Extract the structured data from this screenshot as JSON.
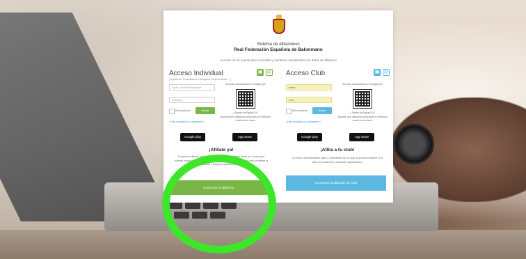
{
  "header": {
    "title": "Sistema de afiliaciones",
    "federation": "Real Federación Española de Balonmano",
    "subtitle": "Accede con tu cuenta para consultar y mantener actualizados tus datos de afiliación"
  },
  "individual": {
    "title": "Acceso Individual",
    "note": "(Jugadores, Entrenadores, Delegados, Responsables, ...)",
    "email_placeholder": "Email o DNI/NIE/Pasaporte",
    "password_placeholder": "Password",
    "remember_label": "Recuerdame",
    "login_button": "Entrar",
    "forgot_link": "¿Has olvidado tu contraseña?",
    "qr_label": "Accede escaneando el código QR",
    "app_question": "¿Tienes imSquad ID?",
    "app_text": "Accede a tu afiliación utilizando tu teléfono móvil como llave.",
    "google_play": "Google play",
    "app_store": "App Store",
    "affiliate_heading": "¡Afíliate ya!",
    "affiliate_text": "Si quieres afiliarte, pulsa en el botón de abajo. Debes tener en cuenta que cuando hayas rellenado el formulario, deberás esperar a que tu club confirme la afiliación y después podrás acceder.",
    "start_button": "Comenzar la afiliación"
  },
  "club": {
    "title": "Acceso Club",
    "user_value": "fuelon",
    "password_value": "••••••",
    "remember_label": "Recuerdame",
    "login_button": "Entrar",
    "forgot_link": "¿Has olvidado tu contraseña?",
    "qr_label": "Accede escaneando el código QR",
    "app_question": "¿Tienes imSquad ID?",
    "app_text": "Accede a tu afiliación utilizando tu teléfono móvil como llave.",
    "google_play": "Google play",
    "app_store": "App Store",
    "affiliate_heading": "¡Afilia a tu club!",
    "affiliate_text": "Si eres el representante legal o presidente de un club ya puedes inscribir a tu club en el sistema y empezar a gestionarlo.",
    "start_button": "Comenzar la afiliación de Club"
  },
  "colors": {
    "green": "#7ab547",
    "blue": "#5bb8e0",
    "highlight_circle": "#3ee62a"
  },
  "icons": {
    "qr": "qr-code-icon",
    "mail": "mail-icon"
  }
}
